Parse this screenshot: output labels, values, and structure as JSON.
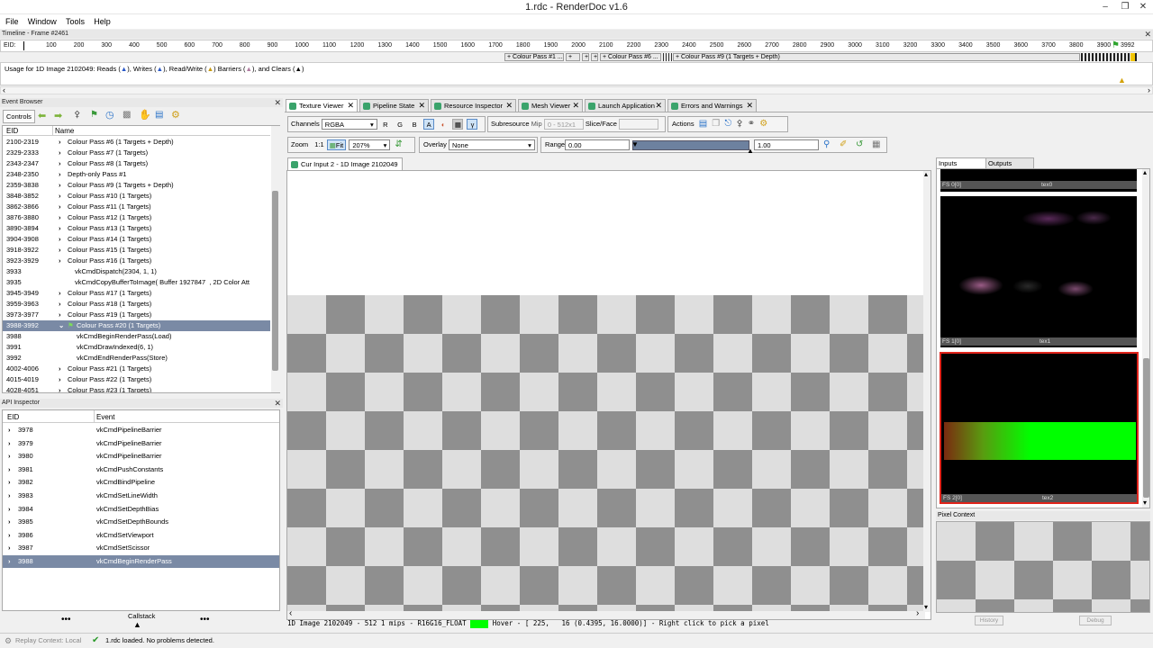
{
  "window": {
    "title": "1.rdc - RenderDoc v1.6"
  },
  "menu": [
    "File",
    "Window",
    "Tools",
    "Help"
  ],
  "timeline": {
    "header": "Timeline - Frame #2461",
    "eid_label": "EID:",
    "ticks": [
      "100",
      "200",
      "300",
      "400",
      "500",
      "600",
      "700",
      "800",
      "900",
      "1000",
      "1100",
      "1200",
      "1300",
      "1400",
      "1500",
      "1600",
      "1700",
      "1800",
      "1900",
      "2000",
      "2100",
      "2200",
      "2300",
      "2400",
      "2500",
      "2600",
      "2700",
      "2800",
      "2900",
      "3000",
      "3100",
      "3200",
      "3300",
      "3400",
      "3500",
      "3600",
      "3700",
      "3800",
      "3900"
    ],
    "current_marker": "3992",
    "passes": [
      "+ Colour Pass #1 ...",
      "+",
      "+",
      "+",
      "+ Colour Pass #6 ...",
      "+ Colour Pass #9 (1 Targets + Depth)"
    ],
    "usage": {
      "p1": "Usage for 1D Image 2102049: Reads (",
      "p2": "), Writes (",
      "p3": "), Read/Write (",
      "p4": ") Barriers (",
      "p5": "), and Clears (",
      "p6": ")"
    }
  },
  "event_browser": {
    "title": "Event Browser",
    "controls_label": "Controls",
    "col_eid": "EID",
    "col_name": "Name",
    "rows": [
      {
        "eid": "2100-2319",
        "name": "Colour Pass #6 (1 Targets + Depth)",
        "indent": 0,
        "exp": "›"
      },
      {
        "eid": "2329-2333",
        "name": "Colour Pass #7 (1 Targets)",
        "indent": 0,
        "exp": "›"
      },
      {
        "eid": "2343-2347",
        "name": "Colour Pass #8 (1 Targets)",
        "indent": 0,
        "exp": "›"
      },
      {
        "eid": "2348-2350",
        "name": "Depth-only Pass #1",
        "indent": 0,
        "exp": "›"
      },
      {
        "eid": "2359-3838",
        "name": "Colour Pass #9 (1 Targets + Depth)",
        "indent": 0,
        "exp": "›"
      },
      {
        "eid": "3848-3852",
        "name": "Colour Pass #10 (1 Targets)",
        "indent": 0,
        "exp": "›"
      },
      {
        "eid": "3862-3866",
        "name": "Colour Pass #11 (1 Targets)",
        "indent": 0,
        "exp": "›"
      },
      {
        "eid": "3876-3880",
        "name": "Colour Pass #12 (1 Targets)",
        "indent": 0,
        "exp": "›"
      },
      {
        "eid": "3890-3894",
        "name": "Colour Pass #13 (1 Targets)",
        "indent": 0,
        "exp": "›"
      },
      {
        "eid": "3904-3908",
        "name": "Colour Pass #14 (1 Targets)",
        "indent": 0,
        "exp": "›"
      },
      {
        "eid": "3918-3922",
        "name": "Colour Pass #15 (1 Targets)",
        "indent": 0,
        "exp": "›"
      },
      {
        "eid": "3923-3929",
        "name": "Colour Pass #16 (1 Targets)",
        "indent": 0,
        "exp": "›"
      },
      {
        "eid": "3933",
        "name": "vkCmdDispatch(2304, 1, 1)",
        "indent": 1,
        "exp": ""
      },
      {
        "eid": "3935",
        "name": "vkCmdCopyBufferToImage( Buffer 1927847  , 2D Color Att",
        "indent": 1,
        "exp": ""
      },
      {
        "eid": "3945-3949",
        "name": "Colour Pass #17 (1 Targets)",
        "indent": 0,
        "exp": "›"
      },
      {
        "eid": "3959-3963",
        "name": "Colour Pass #18 (1 Targets)",
        "indent": 0,
        "exp": "›"
      },
      {
        "eid": "3973-3977",
        "name": "Colour Pass #19 (1 Targets)",
        "indent": 0,
        "exp": "›"
      },
      {
        "eid": "3988-3992",
        "name": "Colour Pass #20 (1 Targets)",
        "indent": 0,
        "exp": "⌄",
        "selected": true
      },
      {
        "eid": "3988",
        "name": "vkCmdBeginRenderPass(Load)",
        "indent": 2,
        "exp": ""
      },
      {
        "eid": "3991",
        "name": "vkCmdDrawIndexed(6, 1)",
        "indent": 2,
        "exp": ""
      },
      {
        "eid": "3992",
        "name": "vkCmdEndRenderPass(Store)",
        "indent": 2,
        "exp": ""
      },
      {
        "eid": "4002-4006",
        "name": "Colour Pass #21 (1 Targets)",
        "indent": 0,
        "exp": "›"
      },
      {
        "eid": "4015-4019",
        "name": "Colour Pass #22 (1 Targets)",
        "indent": 0,
        "exp": "›"
      },
      {
        "eid": "4028-4051",
        "name": "Colour Pass #23 (1 Targets)",
        "indent": 0,
        "exp": "›"
      }
    ]
  },
  "api_inspector": {
    "title": "API Inspector",
    "col_eid": "EID",
    "col_event": "Event",
    "rows": [
      {
        "eid": "3978",
        "event": "vkCmdPipelineBarrier"
      },
      {
        "eid": "3979",
        "event": "vkCmdPipelineBarrier"
      },
      {
        "eid": "3980",
        "event": "vkCmdPipelineBarrier"
      },
      {
        "eid": "3981",
        "event": "vkCmdPushConstants"
      },
      {
        "eid": "3982",
        "event": "vkCmdBindPipeline"
      },
      {
        "eid": "3983",
        "event": "vkCmdSetLineWidth"
      },
      {
        "eid": "3984",
        "event": "vkCmdSetDepthBias"
      },
      {
        "eid": "3985",
        "event": "vkCmdSetDepthBounds"
      },
      {
        "eid": "3986",
        "event": "vkCmdSetViewport"
      },
      {
        "eid": "3987",
        "event": "vkCmdSetScissor"
      },
      {
        "eid": "3988",
        "event": "vkCmdBeginRenderPass",
        "selected": true
      }
    ],
    "callstack_label": "Callstack",
    "dots": "•••"
  },
  "tabs": [
    {
      "label": "Texture Viewer",
      "active": true
    },
    {
      "label": "Pipeline State"
    },
    {
      "label": "Resource Inspector"
    },
    {
      "label": "Mesh Viewer"
    },
    {
      "label": "Launch Application"
    },
    {
      "label": "Errors and Warnings"
    }
  ],
  "toolbar": {
    "channels_label": "Channels",
    "channels_value": "RGBA",
    "r": "R",
    "g": "G",
    "b": "B",
    "a": "A",
    "gamma": "γ",
    "subresource_label": "Subresource",
    "mip_label": "Mip",
    "mip_value": "0 - 512x1",
    "slice_label": "Slice/Face",
    "actions_label": "Actions",
    "zoom_label": "Zoom",
    "zoom_1to1": "1:1",
    "fit_label": "Fit",
    "zoom_value": "207%",
    "overlay_label": "Overlay",
    "overlay_value": "None",
    "range_label": "Range",
    "range_min": "0.00",
    "range_max": "1.00"
  },
  "texture": {
    "tab_label": "Cur Input 2 - 1D Image 2102049",
    "status": "1D Image 2102049 - 512 1 mips - R16G16_FLOAT",
    "hover": "Hover - [ 225,   16 (0.4395, 16.0000)] - Right click to pick a pixel"
  },
  "thumbs": {
    "tab_inputs": "Inputs",
    "tab_outputs": "Outputs",
    "items": [
      {
        "slot": "FS 0[0]",
        "name": "tex0"
      },
      {
        "slot": "FS 1[0]",
        "name": "tex1"
      },
      {
        "slot": "FS 2[0]",
        "name": "tex2"
      }
    ]
  },
  "pixel_context": {
    "title": "Pixel Context",
    "history": "History",
    "debug": "Debug"
  },
  "status": {
    "replay": "Replay Context: Local",
    "message": "1.rdc loaded. No problems detected."
  },
  "colors": {
    "accent_green": "#00ff00",
    "selection": "#7a8aa5",
    "red_border": "#e0241b"
  }
}
